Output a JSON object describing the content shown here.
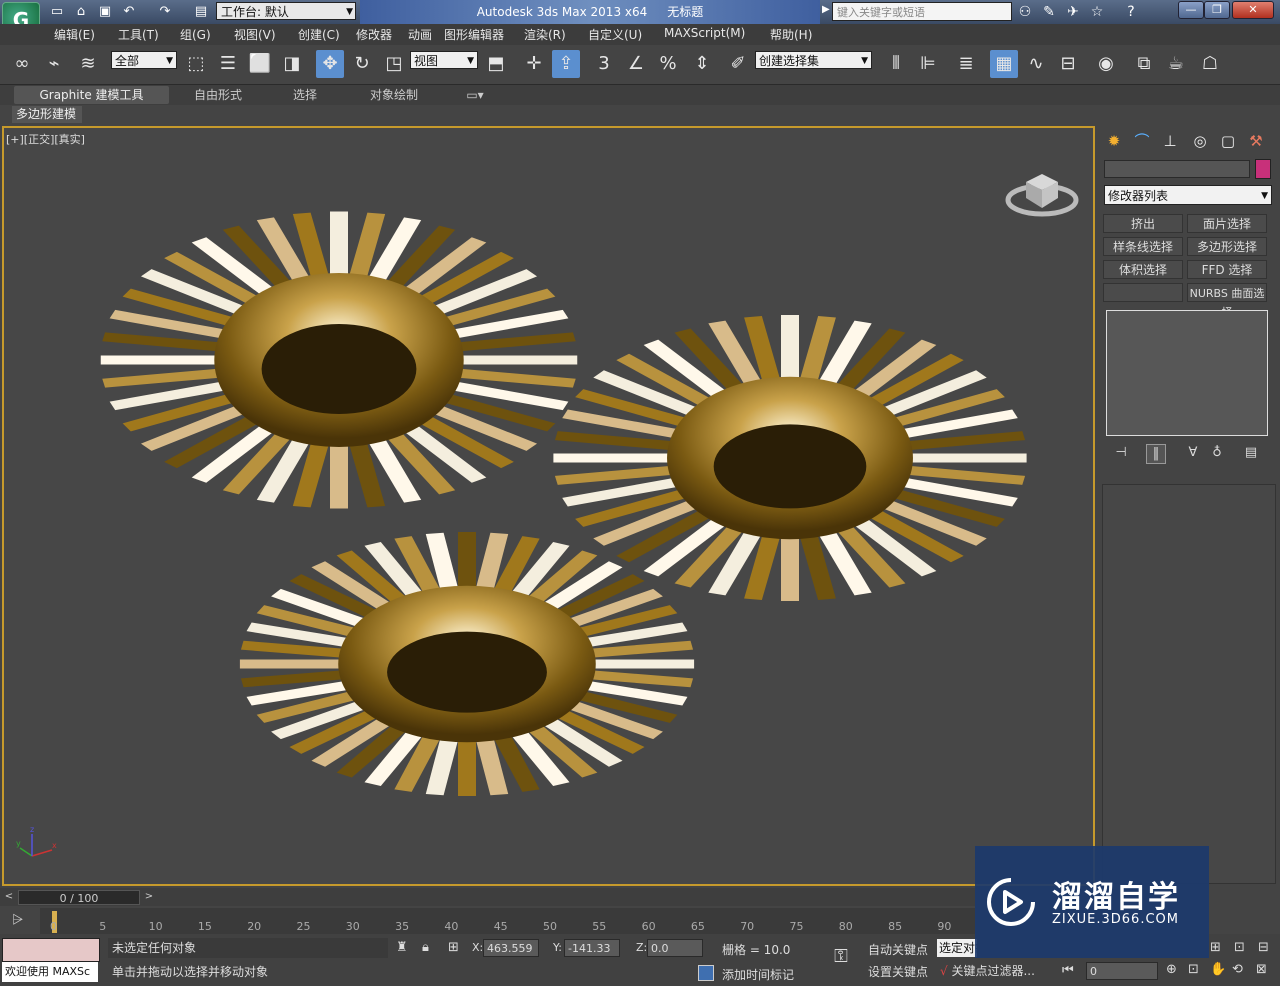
{
  "titlebar": {
    "logo": "G",
    "quick_access": [
      "new-icon",
      "open-icon",
      "save-icon",
      "undo-icon",
      "redo-icon",
      "project-folder-icon"
    ],
    "workspace": "工作台: 默认",
    "app_title": "Autodesk 3ds Max  2013 x64",
    "doc_title": "无标题",
    "search_placeholder": "键入关键字或短语",
    "right_icons": [
      "binoculars-icon",
      "tools-icon",
      "satellite-icon",
      "star-icon",
      "help-icon"
    ]
  },
  "menu": [
    "编辑(E)",
    "工具(T)",
    "组(G)",
    "视图(V)",
    "创建(C)",
    "修改器",
    "动画",
    "图形编辑器",
    "渲染(R)",
    "自定义(U)",
    "MAXScript(M)",
    "帮助(H)"
  ],
  "toolbar": {
    "selection_filter": "全部",
    "ref_coord": "视图",
    "named_selection": "创建选择集",
    "snap_label": "3"
  },
  "ribbon": {
    "tabs": [
      "Graphite 建模工具",
      "自由形式",
      "选择",
      "对象绘制"
    ],
    "panel": "多边形建模"
  },
  "viewport": {
    "label": "[+][正交][真实]"
  },
  "command_panel": {
    "modifier_list": "修改器列表",
    "buttons": [
      "挤出",
      "面片选择",
      "样条线选择",
      "多边形选择",
      "体积选择",
      "FFD 选择",
      "",
      "NURBS 曲面选择"
    ]
  },
  "timeline": {
    "slider": "0 / 100",
    "ticks": [
      "0",
      "5",
      "10",
      "15",
      "20",
      "25",
      "30",
      "35",
      "40",
      "45",
      "50",
      "55",
      "60",
      "65",
      "70",
      "75",
      "80",
      "85",
      "90"
    ]
  },
  "status": {
    "welcome": "欢迎使用 MAXSc",
    "selection": "未选定任何对象",
    "prompt": "单击并拖动以选择并移动对象",
    "x": "463.559",
    "y": "-141.33",
    "z": "0.0",
    "grid": "栅格 = 10.0",
    "add_time_tag": "添加时间标记",
    "auto_key": "自动关键点",
    "set_key": "设置关键点",
    "selected": "选定对象",
    "key_filters": "关键点过滤器...",
    "frame": "0"
  },
  "watermark": {
    "title": "溜溜自学",
    "url": "ZIXUE.3D66.COM"
  },
  "colors": {
    "viewport_border": "#c69a2c",
    "gold": "#a07820",
    "active_button": "#5b8fcf"
  }
}
